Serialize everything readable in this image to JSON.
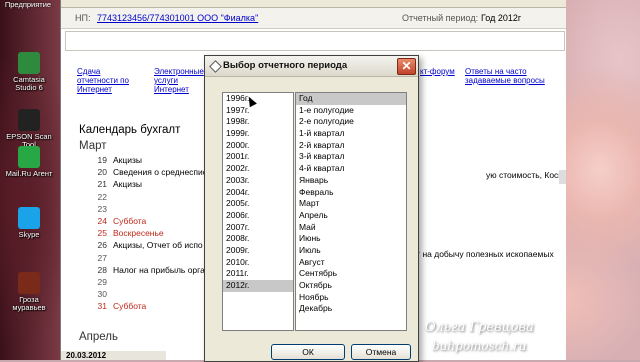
{
  "desktop": {
    "top_label": "Предприятие",
    "icons": [
      {
        "label": "Camtasia Studio 6",
        "icon": "camtasia-icon",
        "color": "#2e8b3e"
      },
      {
        "label": "EPSON Scan Tool",
        "icon": "printer-icon",
        "color": "#222222"
      },
      {
        "label": "Mail.Ru Агент",
        "icon": "mailru-agent-icon",
        "color": "#27a844"
      },
      {
        "label": "Skype",
        "icon": "skype-icon",
        "color": "#1aa3e8"
      },
      {
        "label": "Гроза муравьев",
        "icon": "ant-icon",
        "color": "#7a2a18"
      }
    ]
  },
  "app": {
    "np_label": "НП:",
    "np_value": "7743123456/774301001 ООО \"Фиалка\"",
    "period_label": "Отчетный период:",
    "period_value": "Год   2012г",
    "links": [
      "Сдача отчетности по Интернет",
      "Электронные услуги Интернет",
      "Ответы на часто задаваемые вопросы"
    ],
    "link_fragment": "кт-форум",
    "calendar_title": "Календарь бухгалт",
    "months": [
      "Март",
      "Апрель"
    ],
    "days": [
      {
        "d": "19",
        "t": "Акцизы",
        "hol": false
      },
      {
        "d": "20",
        "t": "Сведения о среднеспис",
        "hol": false
      },
      {
        "d": "21",
        "t": "Акцизы",
        "hol": false
      },
      {
        "d": "22",
        "t": "",
        "hol": false
      },
      {
        "d": "23",
        "t": "",
        "hol": false
      },
      {
        "d": "24",
        "t": "Суббота",
        "hol": true
      },
      {
        "d": "25",
        "t": "Воскресенье",
        "hol": true
      },
      {
        "d": "26",
        "t": "Акцизы, Отчет об испо",
        "hol": false
      },
      {
        "d": "27",
        "t": "",
        "hol": false
      },
      {
        "d": "28",
        "t": "Налог на прибыль орга",
        "hol": false
      },
      {
        "d": "29",
        "t": "",
        "hol": false
      },
      {
        "d": "30",
        "t": "",
        "hol": false
      },
      {
        "d": "31",
        "t": "Суббота",
        "hol": true
      }
    ],
    "right_text_a": "ую стоимость, Косвенные налоги, Н",
    "right_text_b": "г на добычу полезных ископаемых",
    "footer_date": "20.03.2012"
  },
  "dialog": {
    "title": "Выбор отчетного периода",
    "years": [
      "1996г.",
      "1997г.",
      "1998г.",
      "1999г.",
      "2000г.",
      "2001г.",
      "2002г.",
      "2003г.",
      "2004г.",
      "2005г.",
      "2006г.",
      "2007г.",
      "2008г.",
      "2009г.",
      "2010г.",
      "2011г.",
      "2012г."
    ],
    "selected_year": "2012г.",
    "periods": [
      "Год",
      "1-е полугодие",
      "2-е полугодие",
      "1-й квартал",
      "2-й квартал",
      "3-й квартал",
      "4-й квартал",
      "Январь",
      "Февраль",
      "Март",
      "Апрель",
      "Май",
      "Июнь",
      "Июль",
      "Август",
      "Сентябрь",
      "Октябрь",
      "Ноябрь",
      "Декабрь"
    ],
    "selected_period": "Год",
    "ok_label": "ОК",
    "cancel_label": "Отмена",
    "close_label": "✕"
  },
  "watermark": {
    "name": "Ольга Гревцова",
    "site": "buhpomosch.ru"
  }
}
